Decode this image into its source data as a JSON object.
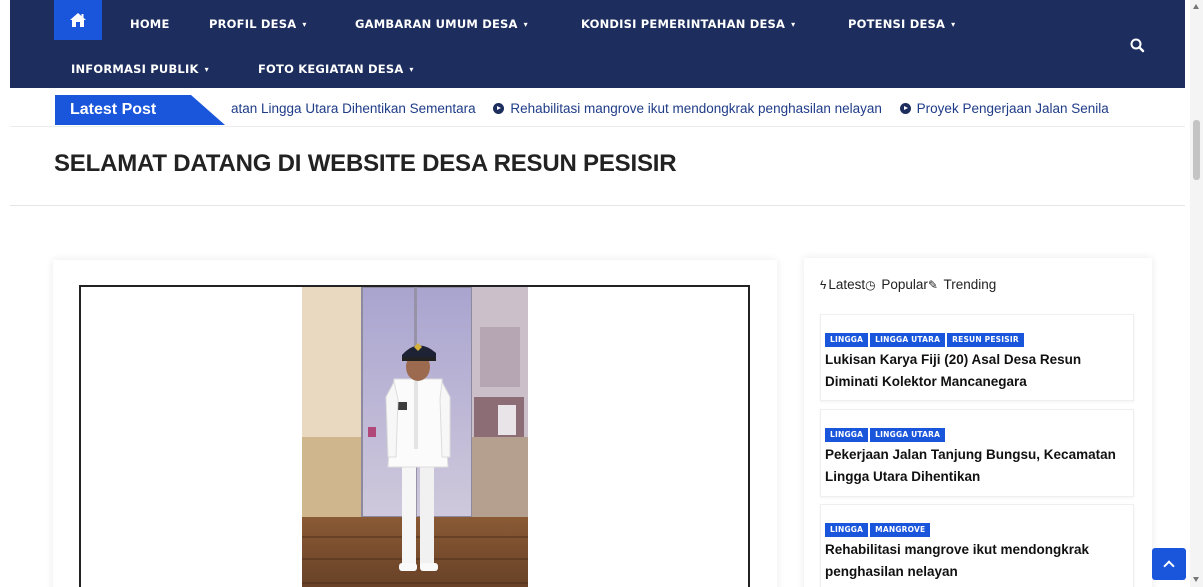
{
  "nav": {
    "home_icon": "home-icon",
    "items": [
      {
        "label": "HOME",
        "dropdown": false
      },
      {
        "label": "PROFIL DESA",
        "dropdown": true
      },
      {
        "label": "GAMBARAN UMUM DESA",
        "dropdown": true
      },
      {
        "label": "KONDISI PEMERINTAHAN DESA",
        "dropdown": true
      },
      {
        "label": "POTENSI DESA",
        "dropdown": true
      },
      {
        "label": "INFORMASI PUBLIK",
        "dropdown": true
      },
      {
        "label": "FOTO KEGIATAN DESA",
        "dropdown": true
      }
    ],
    "caret": "▾",
    "search_icon": "search-icon"
  },
  "ticker": {
    "label": "Latest Post",
    "items": [
      "atan Lingga Utara Dihentikan Sementara",
      "Rehabilitasi mangrove ikut mendongkrak penghasilan nelayan",
      "Proyek Pengerjaan Jalan Senila"
    ]
  },
  "page": {
    "title": "SELAMAT DATANG DI WEBSITE DESA RESUN PESISIR"
  },
  "sidebar": {
    "tabs": [
      {
        "icon": "ϟ",
        "label": "Latest"
      },
      {
        "icon": "◷",
        "label": " Popular"
      },
      {
        "icon": "✎",
        "label": " Trending"
      }
    ],
    "posts": [
      {
        "tags": [
          "LINGGA",
          "LINGGA UTARA",
          "RESUN PESISIR"
        ],
        "title": "Lukisan Karya Fiji (20) Asal Desa Resun Diminati Kolektor Mancanegara"
      },
      {
        "tags": [
          "LINGGA",
          "LINGGA UTARA"
        ],
        "title": "Pekerjaan Jalan Tanjung Bungsu, Kecamatan Lingga Utara Dihentikan"
      },
      {
        "tags": [
          "LINGGA",
          "MANGROVE"
        ],
        "title": "Rehabilitasi mangrove ikut mendongkrak penghasilan nelayan"
      }
    ]
  },
  "colors": {
    "navbar": "#1c2d5e",
    "accent": "#1a56db"
  }
}
